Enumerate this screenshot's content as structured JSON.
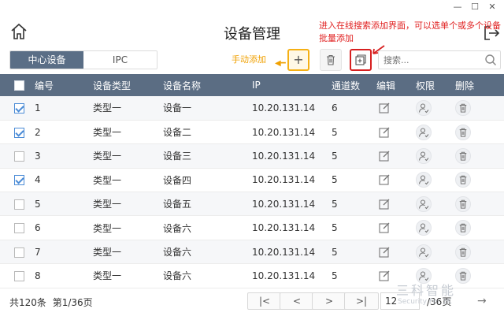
{
  "window": {
    "minimize": "—",
    "maximize": "☐",
    "close": "✕"
  },
  "header": {
    "title": "设备管理"
  },
  "annotations": {
    "batch_note": "进入在线搜索添加界面，可以选单个或多个设备批量添加",
    "manual_add_note": "手动添加"
  },
  "tabs": [
    {
      "label": "中心设备",
      "active": true
    },
    {
      "label": "IPC",
      "active": false
    }
  ],
  "toolbar": {
    "add_label": "+",
    "search_placeholder": "搜索..."
  },
  "table": {
    "columns": [
      "编号",
      "设备类型",
      "设备名称",
      "IP",
      "通道数",
      "编辑",
      "权限",
      "删除"
    ],
    "rows": [
      {
        "checked": true,
        "num": "1",
        "type": "类型一",
        "name": "设备一",
        "ip": "10.20.131.14",
        "channels": "6"
      },
      {
        "checked": true,
        "num": "2",
        "type": "类型一",
        "name": "设备二",
        "ip": "10.20.131.14",
        "channels": "5"
      },
      {
        "checked": false,
        "num": "3",
        "type": "类型一",
        "name": "设备三",
        "ip": "10.20.131.14",
        "channels": "5"
      },
      {
        "checked": true,
        "num": "4",
        "type": "类型一",
        "name": "设备四",
        "ip": "10.20.131.14",
        "channels": "5"
      },
      {
        "checked": false,
        "num": "5",
        "type": "类型一",
        "name": "设备五",
        "ip": "10.20.131.14",
        "channels": "5"
      },
      {
        "checked": false,
        "num": "6",
        "type": "类型一",
        "name": "设备六",
        "ip": "10.20.131.14",
        "channels": "5"
      },
      {
        "checked": false,
        "num": "7",
        "type": "类型一",
        "name": "设备六",
        "ip": "10.20.131.14",
        "channels": "5"
      },
      {
        "checked": false,
        "num": "8",
        "type": "类型一",
        "name": "设备六",
        "ip": "10.20.131.14",
        "channels": "5"
      }
    ]
  },
  "pagination": {
    "total": "共120条",
    "page": "第1/36页",
    "first": "|<",
    "prev": "<",
    "next": ">",
    "last": ">|",
    "input_value": "12",
    "page_count": "/36页"
  },
  "watermark": {
    "brand": "三科智能",
    "sub": "Security For 3K"
  }
}
